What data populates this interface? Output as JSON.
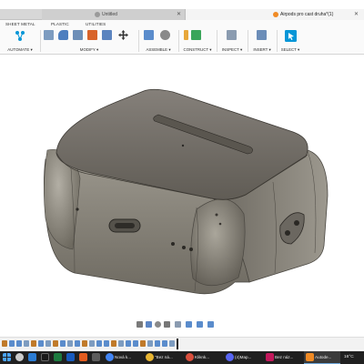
{
  "tabs": [
    {
      "label": "Untitled",
      "active": false
    },
    {
      "label": "Airpods pro cast druha*(1)",
      "active": true
    }
  ],
  "toolbar": {
    "tabs": [
      "SHEET METAL",
      "PLASTIC",
      "UTILITIES"
    ],
    "groups": [
      {
        "label": "AUTOMATE ▾"
      },
      {
        "label": "MODIFY ▾"
      },
      {
        "label": "ASSEMBLE ▾"
      },
      {
        "label": "CONSTRUCT ▾"
      },
      {
        "label": "INSPECT ▾"
      },
      {
        "label": "INSERT ▾"
      },
      {
        "label": "SELECT ▾"
      }
    ]
  },
  "taskbar": {
    "items": [
      {
        "label": "Nová k..."
      },
      {
        "label": "\"Bez ná..."
      },
      {
        "label": "Kliknk..."
      },
      {
        "label": "(4)Map..."
      },
      {
        "label": "Bez náz..."
      },
      {
        "label": "Autode..."
      }
    ],
    "temperature": "16°C"
  },
  "colors": {
    "accent": "#0696d7",
    "case_body": "#8a8577",
    "case_lid": "#6f6b63",
    "taskbar": "#202020"
  }
}
